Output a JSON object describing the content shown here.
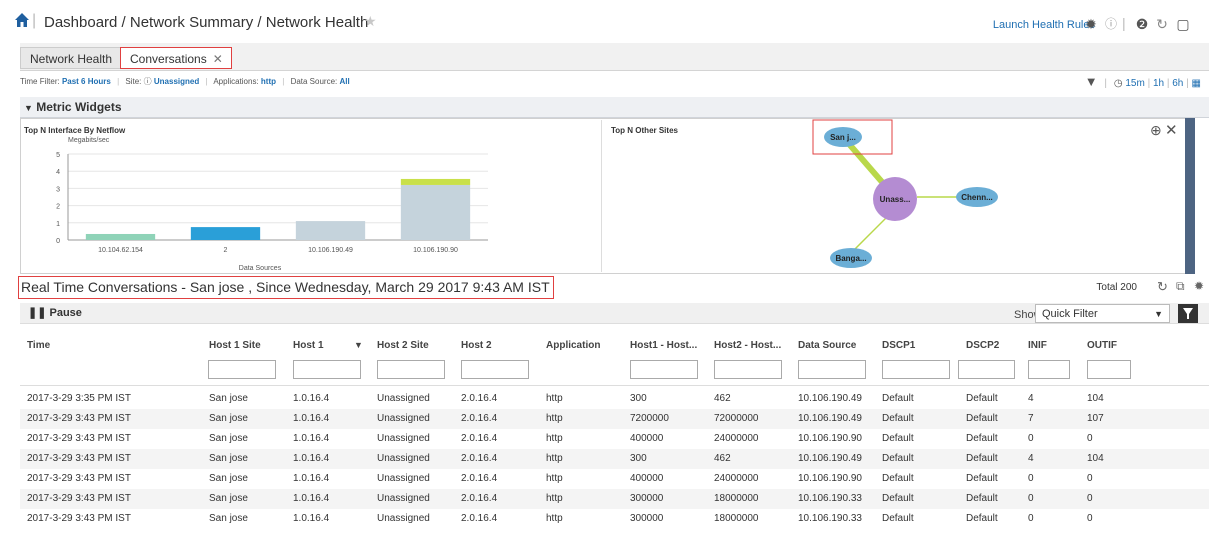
{
  "header": {
    "breadcrumb": "Dashboard / Network Summary / Network Health",
    "launch_link": "Launch Health Rules",
    "icons": [
      "home-icon",
      "star-icon",
      "gear-icon",
      "info-icon",
      "help-icon",
      "refresh-icon",
      "window-icon"
    ]
  },
  "tabs": [
    {
      "label": "Network Health",
      "active": false
    },
    {
      "label": "Conversations",
      "active": true,
      "close": "✕"
    }
  ],
  "filter_bar": {
    "time_label": "Time Filter:",
    "time_value": "Past 6 Hours",
    "site_label": "Site:",
    "site_value": "Unassigned",
    "apps_label": "Applications:",
    "apps_value": "http",
    "ds_label": "Data Source:",
    "ds_value": "All",
    "time_options": [
      "15m",
      "1h",
      "6h"
    ]
  },
  "metric_widgets": {
    "section_label": "Metric Widgets",
    "left_widget_title": "Top N Interface By Netflow",
    "right_widget_title": "Top N Other Sites"
  },
  "chart_data": {
    "type": "bar",
    "title": "Top N Interface By Netflow",
    "ylabel": "Megabits/sec",
    "xlabel": "Data Sources",
    "ylim": [
      0,
      5
    ],
    "yticks": [
      0,
      1,
      2,
      3,
      4,
      5
    ],
    "categories": [
      "10.104.62.154",
      "2",
      "10.106.190.49",
      "10.106.190.90"
    ],
    "series": [
      {
        "values": [
          0.35,
          0.75,
          1.1,
          3.2
        ],
        "colors": [
          "#8fd3b8",
          "#2a9fd8",
          "#c5d3dc",
          "#c5d3dc"
        ]
      },
      {
        "values": [
          0,
          0,
          0,
          0.35
        ],
        "colors": [
          "#c9e04a",
          "#c9e04a",
          "#c9e04a",
          "#c9e04a"
        ]
      }
    ]
  },
  "site_graph": {
    "center": "Unass...",
    "nodes": [
      "San j...",
      "Chenn...",
      "Banga..."
    ]
  },
  "conversations": {
    "title": "Real Time Conversations - San jose , Since Wednesday, March 29 2017 9:43 AM IST",
    "total": "Total 200",
    "pause_label": "Pause",
    "show_label": "Show",
    "filter_select": "Quick Filter"
  },
  "table": {
    "columns": [
      "Time",
      "Host 1 Site",
      "Host 1",
      "Host 2 Site",
      "Host 2",
      "Application",
      "Host1 - Host...",
      "Host2 - Host...",
      "Data Source",
      "DSCP1",
      "DSCP2",
      "INIF",
      "OUTIF"
    ],
    "rows": [
      [
        "2017-3-29 3:35 PM IST",
        "San jose",
        "1.0.16.4",
        "Unassigned",
        "2.0.16.4",
        "http",
        "300",
        "462",
        "10.106.190.49",
        "Default",
        "Default",
        "4",
        "104"
      ],
      [
        "2017-3-29 3:43 PM IST",
        "San jose",
        "1.0.16.4",
        "Unassigned",
        "2.0.16.4",
        "http",
        "7200000",
        "72000000",
        "10.106.190.49",
        "Default",
        "Default",
        "7",
        "107"
      ],
      [
        "2017-3-29 3:43 PM IST",
        "San jose",
        "1.0.16.4",
        "Unassigned",
        "2.0.16.4",
        "http",
        "400000",
        "24000000",
        "10.106.190.90",
        "Default",
        "Default",
        "0",
        "0"
      ],
      [
        "2017-3-29 3:43 PM IST",
        "San jose",
        "1.0.16.4",
        "Unassigned",
        "2.0.16.4",
        "http",
        "300",
        "462",
        "10.106.190.49",
        "Default",
        "Default",
        "4",
        "104"
      ],
      [
        "2017-3-29 3:43 PM IST",
        "San jose",
        "1.0.16.4",
        "Unassigned",
        "2.0.16.4",
        "http",
        "400000",
        "24000000",
        "10.106.190.90",
        "Default",
        "Default",
        "0",
        "0"
      ],
      [
        "2017-3-29 3:43 PM IST",
        "San jose",
        "1.0.16.4",
        "Unassigned",
        "2.0.16.4",
        "http",
        "300000",
        "18000000",
        "10.106.190.33",
        "Default",
        "Default",
        "0",
        "0"
      ],
      [
        "2017-3-29 3:43 PM IST",
        "San jose",
        "1.0.16.4",
        "Unassigned",
        "2.0.16.4",
        "http",
        "300000",
        "18000000",
        "10.106.190.33",
        "Default",
        "Default",
        "0",
        "0"
      ]
    ]
  }
}
